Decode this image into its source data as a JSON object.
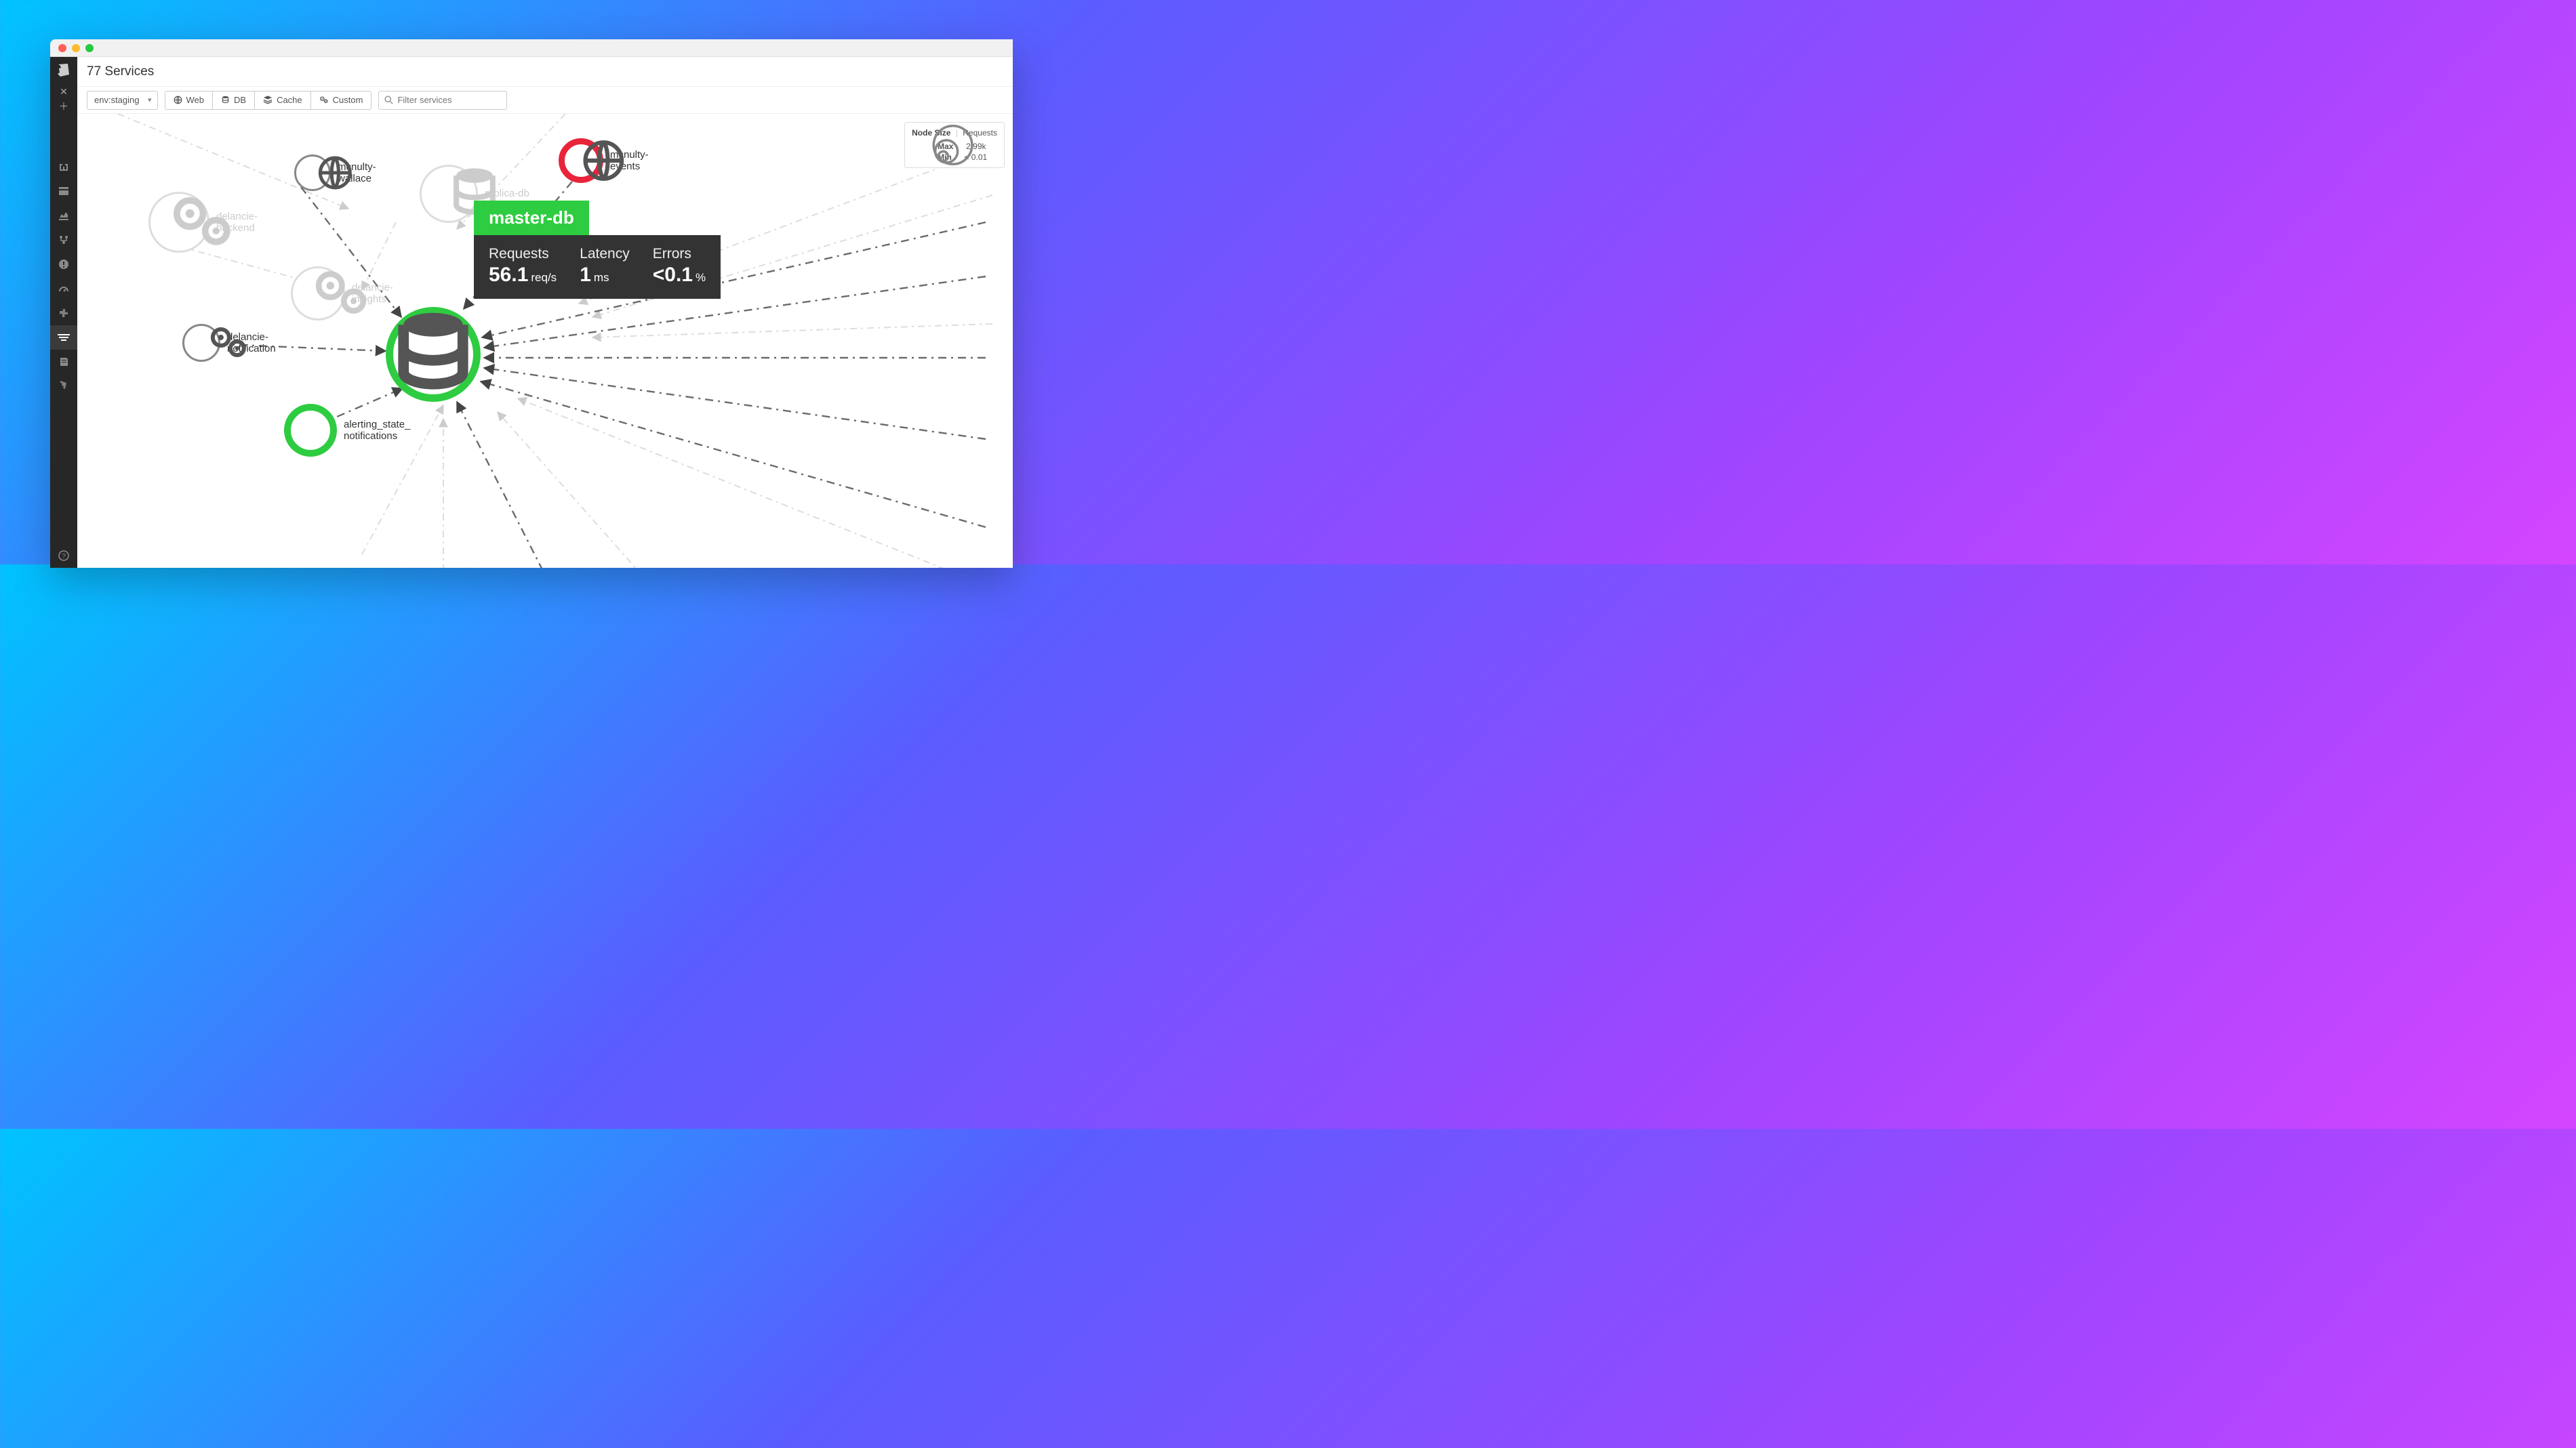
{
  "header": {
    "title": "77 Services"
  },
  "toolbar": {
    "env_label": "env:staging",
    "filters": {
      "web": "Web",
      "db": "DB",
      "cache": "Cache",
      "custom": "Custom"
    },
    "search_placeholder": "Filter services"
  },
  "legend": {
    "title": "Node Size",
    "metric": "Requests",
    "max_label": "Max",
    "max_value": "2.99k",
    "min_label": "Min",
    "min_value": "< 0.01"
  },
  "tooltip": {
    "service": "master-db",
    "stats": {
      "requests": {
        "label": "Requests",
        "value": "56.1",
        "unit": "req/s"
      },
      "latency": {
        "label": "Latency",
        "value": "1",
        "unit": "ms"
      },
      "errors": {
        "label": "Errors",
        "value": "<0.1",
        "unit": "%"
      }
    }
  },
  "nodes": {
    "master_db": {
      "label": "master-db"
    },
    "mcnulty_wallace": {
      "label": "mcnulty-\nwallace"
    },
    "mcnulty_events": {
      "label": "mcnulty-\nevents"
    },
    "delancie_notification": {
      "label": "delancie-\nnotification"
    },
    "alerting_state": {
      "label": "alerting_state_\nnotifications"
    },
    "delancie_backend": {
      "label": "delancie-\nbackend"
    },
    "replica_db": {
      "label": "replica-db"
    },
    "delancie_insights": {
      "label": "delancie-\ninsights"
    }
  },
  "colors": {
    "green": "#2ecc40",
    "red": "#e8253a",
    "gray": "#888",
    "faded": "#ddd"
  }
}
